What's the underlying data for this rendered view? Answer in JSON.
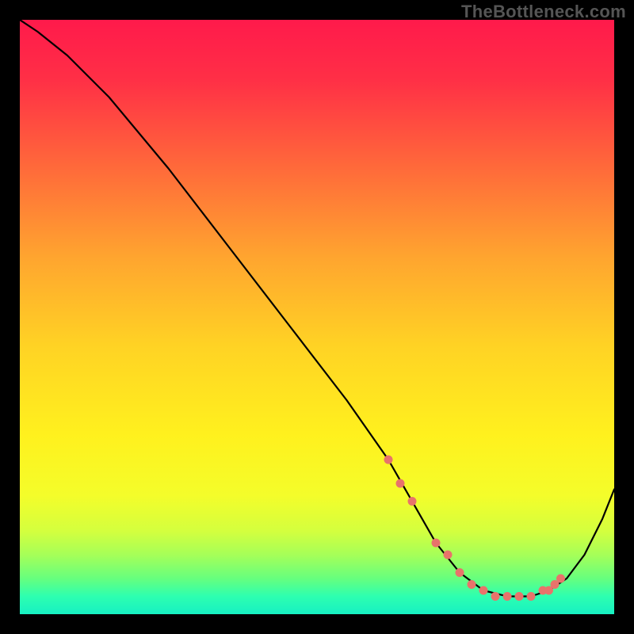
{
  "watermark": "TheBottleneck.com",
  "colors": {
    "background": "#000000",
    "curve": "#000000",
    "dot_fill": "#e8736b",
    "gradient_stops": [
      {
        "offset": 0.0,
        "color": "#ff1a4b"
      },
      {
        "offset": 0.1,
        "color": "#ff2f46"
      },
      {
        "offset": 0.25,
        "color": "#ff6a3a"
      },
      {
        "offset": 0.4,
        "color": "#ffa52f"
      },
      {
        "offset": 0.55,
        "color": "#ffd324"
      },
      {
        "offset": 0.7,
        "color": "#fff11e"
      },
      {
        "offset": 0.8,
        "color": "#f4fd2a"
      },
      {
        "offset": 0.86,
        "color": "#d4ff3e"
      },
      {
        "offset": 0.9,
        "color": "#a6ff58"
      },
      {
        "offset": 0.94,
        "color": "#66ff7e"
      },
      {
        "offset": 0.97,
        "color": "#2dffb0"
      },
      {
        "offset": 1.0,
        "color": "#17f0c3"
      }
    ]
  },
  "chart_data": {
    "type": "line",
    "title": "",
    "xlabel": "",
    "ylabel": "",
    "xlim": [
      0,
      100
    ],
    "ylim": [
      0,
      100
    ],
    "series": [
      {
        "name": "curve",
        "x": [
          0,
          3,
          8,
          15,
          25,
          35,
          45,
          55,
          62,
          66,
          70,
          74,
          78,
          82,
          86,
          89,
          92,
          95,
          98,
          100
        ],
        "y": [
          100,
          98,
          94,
          87,
          75,
          62,
          49,
          36,
          26,
          19,
          12,
          7,
          4,
          3,
          3,
          4,
          6,
          10,
          16,
          21
        ]
      }
    ],
    "dots": {
      "name": "highlight-points",
      "x": [
        62,
        64,
        66,
        70,
        72,
        74,
        76,
        78,
        80,
        82,
        84,
        86,
        88,
        89,
        90,
        91
      ],
      "y": [
        26,
        22,
        19,
        12,
        10,
        7,
        5,
        4,
        3,
        3,
        3,
        3,
        4,
        4,
        5,
        6
      ]
    }
  }
}
